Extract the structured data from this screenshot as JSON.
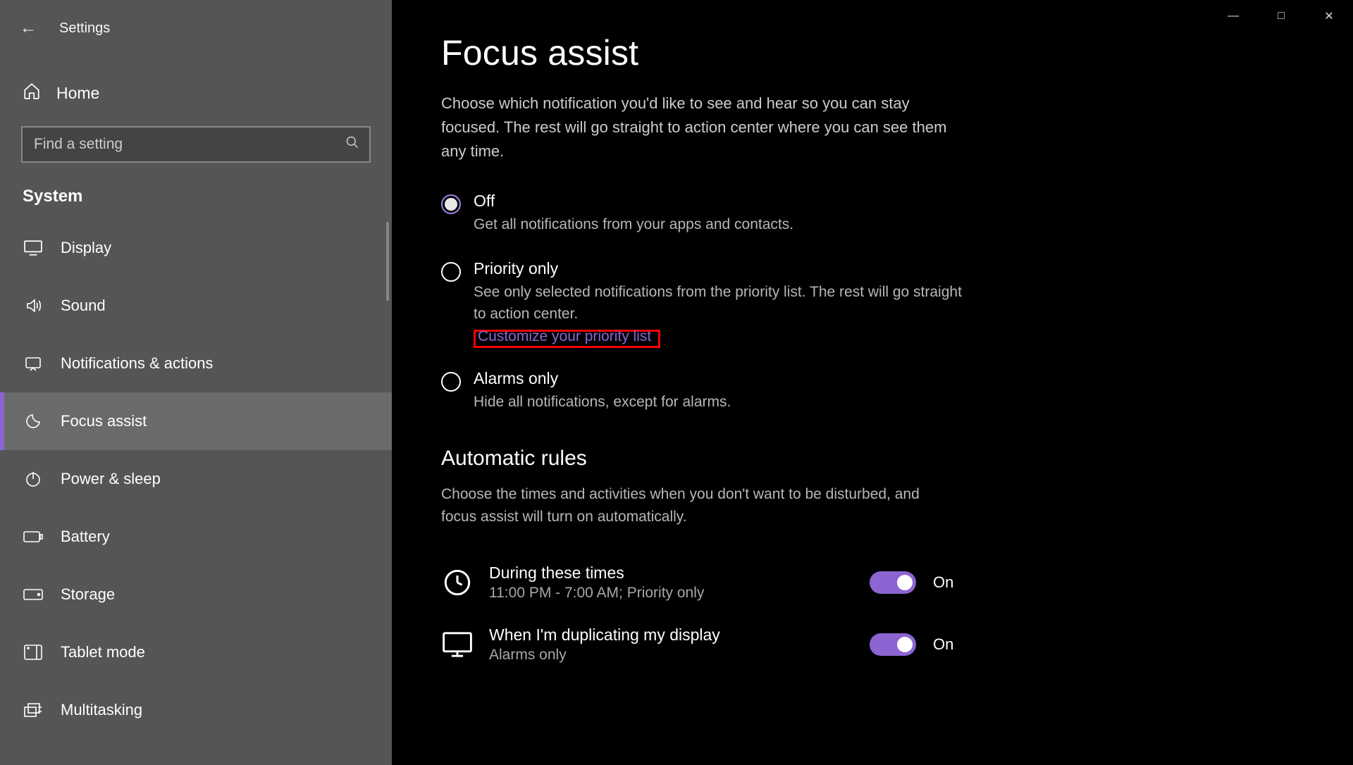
{
  "header": {
    "app_title": "Settings"
  },
  "sidebar": {
    "home_label": "Home",
    "search_placeholder": "Find a setting",
    "section_label": "System",
    "items": [
      {
        "label": "Display",
        "icon": "display"
      },
      {
        "label": "Sound",
        "icon": "sound"
      },
      {
        "label": "Notifications & actions",
        "icon": "notifications"
      },
      {
        "label": "Focus assist",
        "icon": "moon",
        "selected": true
      },
      {
        "label": "Power & sleep",
        "icon": "power"
      },
      {
        "label": "Battery",
        "icon": "battery"
      },
      {
        "label": "Storage",
        "icon": "storage"
      },
      {
        "label": "Tablet mode",
        "icon": "tablet"
      },
      {
        "label": "Multitasking",
        "icon": "multitasking"
      }
    ]
  },
  "page": {
    "title": "Focus assist",
    "description": "Choose which notification you'd like to see and hear so you can stay focused. The rest will go straight to action center where you can see them any time.",
    "options": [
      {
        "title": "Off",
        "desc": "Get all notifications from your apps and contacts.",
        "checked": true
      },
      {
        "title": "Priority only",
        "desc": "See only selected notifications from the priority list. The rest will go straight to action center.",
        "checked": false,
        "link": "Customize your priority list"
      },
      {
        "title": "Alarms only",
        "desc": "Hide all notifications, except for alarms.",
        "checked": false
      }
    ],
    "auto_rules": {
      "heading": "Automatic rules",
      "desc": "Choose the times and activities when you don't want to be disturbed, and focus assist will turn on automatically.",
      "rules": [
        {
          "title": "During these times",
          "sub": "11:00 PM - 7:00 AM; Priority only",
          "state_label": "On",
          "icon": "clock"
        },
        {
          "title": "When I'm duplicating my display",
          "sub": "Alarms only",
          "state_label": "On",
          "icon": "monitor"
        }
      ]
    }
  }
}
